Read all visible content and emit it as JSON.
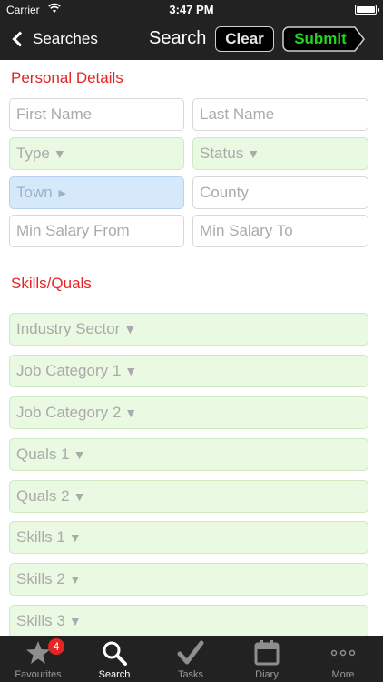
{
  "status_bar": {
    "carrier": "Carrier",
    "time": "3:47 PM"
  },
  "nav": {
    "back_label": "Searches",
    "title": "Search",
    "clear_label": "Clear",
    "submit_label": "Submit"
  },
  "personal": {
    "title": "Personal Details",
    "first_name": "First Name",
    "last_name": "Last Name",
    "type": "Type",
    "status": "Status",
    "town": "Town",
    "county": "County",
    "min_salary_from": "Min Salary From",
    "min_salary_to": "Min Salary To"
  },
  "skills": {
    "title": "Skills/Quals",
    "industry_sector": "Industry Sector",
    "job_category_1": "Job Category 1",
    "job_category_2": "Job Category 2",
    "quals_1": "Quals 1",
    "quals_2": "Quals 2",
    "skills_1": "Skills 1",
    "skills_2": "Skills 2",
    "skills_3": "Skills 3"
  },
  "glyphs": {
    "dropdown": "▼",
    "arrow_right": "►"
  },
  "tabs": {
    "favourites": {
      "label": "Favourites",
      "badge": "4"
    },
    "search": {
      "label": "Search"
    },
    "tasks": {
      "label": "Tasks"
    },
    "diary": {
      "label": "Diary"
    },
    "more": {
      "label": "More"
    }
  },
  "colors": {
    "bar": "#222222",
    "section_red": "#e52424",
    "submit_green": "#22d41f",
    "dropdown_fill": "#eaf9e1",
    "selected_fill": "#d6e9fa"
  }
}
